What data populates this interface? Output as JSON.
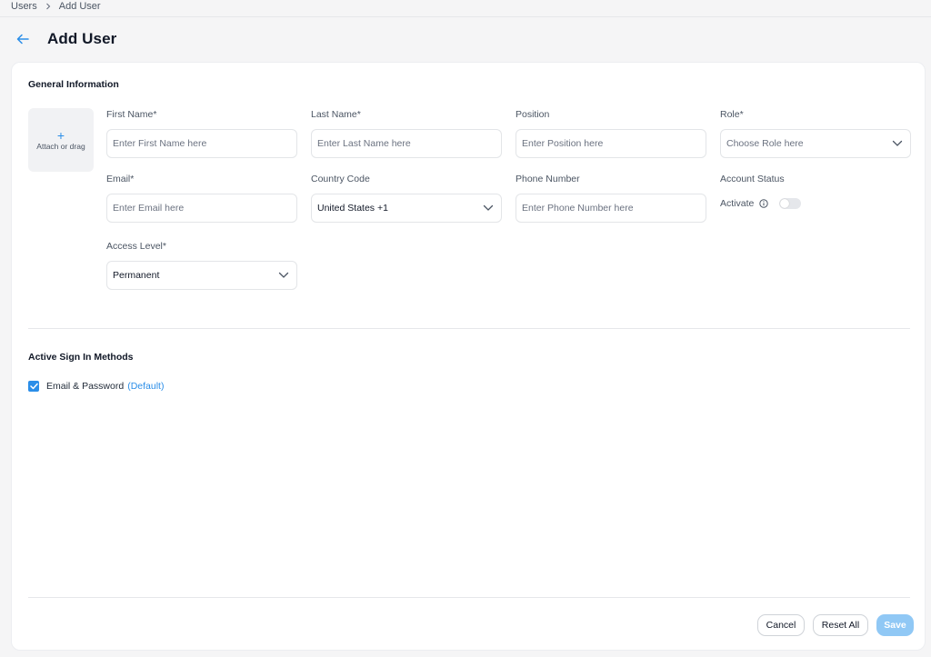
{
  "breadcrumb": {
    "items": [
      "Users",
      "Add User"
    ]
  },
  "header": {
    "title": "Add User"
  },
  "general": {
    "title": "General Information",
    "upload_label": "Attach or drag",
    "first_name": {
      "label": "First Name*",
      "placeholder": "Enter First Name here"
    },
    "last_name": {
      "label": "Last Name*",
      "placeholder": "Enter Last Name here"
    },
    "position": {
      "label": "Position",
      "placeholder": "Enter Position here"
    },
    "role": {
      "label": "Role*",
      "placeholder": "Choose Role here"
    },
    "email": {
      "label": "Email*",
      "placeholder": "Enter Email here"
    },
    "country_code": {
      "label": "Country Code",
      "value": "United States +1"
    },
    "phone": {
      "label": "Phone Number",
      "placeholder": "Enter Phone Number here"
    },
    "account_status": {
      "label": "Account Status",
      "toggle_label": "Activate",
      "active": false
    },
    "access_level": {
      "label": "Access Level*",
      "value": "Permanent"
    }
  },
  "signin": {
    "title": "Active Sign In Methods",
    "methods": [
      {
        "label": "Email & Password",
        "tag": "(Default)",
        "checked": true
      }
    ]
  },
  "footer": {
    "cancel": "Cancel",
    "reset": "Reset All",
    "save": "Save"
  },
  "colors": {
    "accent": "#2b8ee8",
    "save_disabled": "#90c8f5",
    "background": "#f5f5f6"
  },
  "icons": {
    "back": "arrow-left-icon",
    "separator": "chevron-right-icon",
    "dropdown": "chevron-down-icon",
    "info": "info-circle-icon",
    "check": "check-icon",
    "upload": "plus-icon"
  }
}
